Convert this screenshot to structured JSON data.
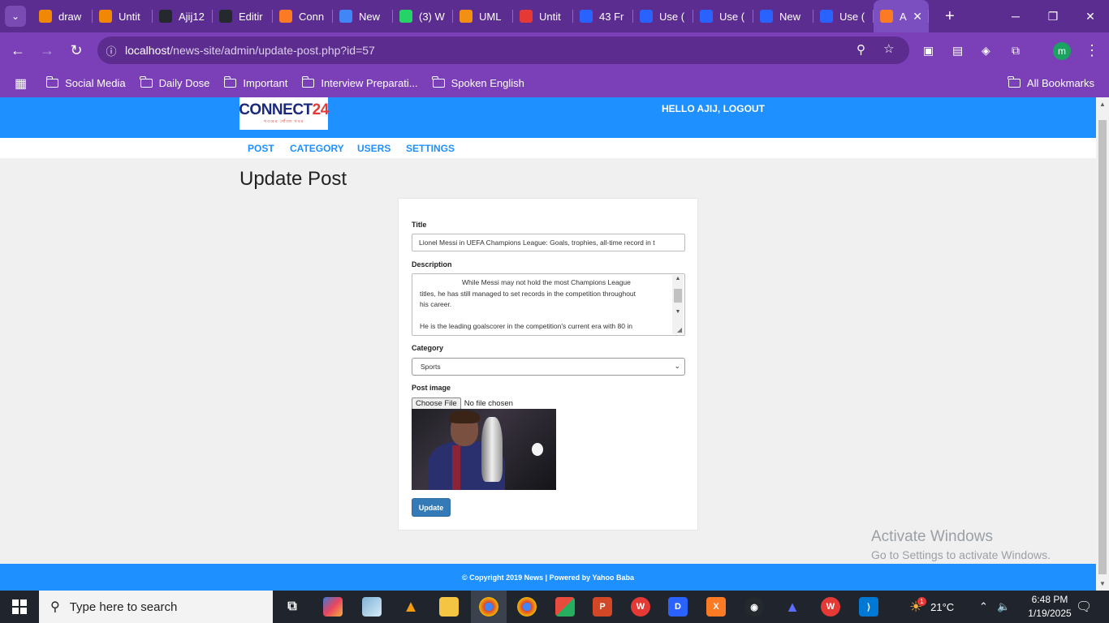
{
  "browser": {
    "tabs": [
      {
        "label": "draw",
        "icon": "drawio-icon",
        "color": "#f08705"
      },
      {
        "label": "Untit",
        "icon": "drawio-icon",
        "color": "#f08705"
      },
      {
        "label": "Ajij12",
        "icon": "github-icon",
        "color": "#24292e"
      },
      {
        "label": "Editir",
        "icon": "github-icon",
        "color": "#24292e"
      },
      {
        "label": "Conn",
        "icon": "xampp-icon",
        "color": "#fb7a24"
      },
      {
        "label": "New",
        "icon": "chrome-icon",
        "color": "#4285f4"
      },
      {
        "label": "(3) W",
        "icon": "whatsapp-icon",
        "color": "#25d366"
      },
      {
        "label": "UML",
        "icon": "uml-icon",
        "color": "#f29111"
      },
      {
        "label": "Untit",
        "icon": "codepen-icon",
        "color": "#e53935"
      },
      {
        "label": "43 Fr",
        "icon": "dsa-icon",
        "color": "#2962ff"
      },
      {
        "label": "Use (",
        "icon": "dsa-icon",
        "color": "#2962ff"
      },
      {
        "label": "Use (",
        "icon": "dsa-icon",
        "color": "#2962ff"
      },
      {
        "label": "New",
        "icon": "dsa-icon",
        "color": "#2962ff"
      },
      {
        "label": "Use (",
        "icon": "dsa-icon",
        "color": "#2962ff"
      }
    ],
    "active_tab": {
      "label": "A",
      "icon": "xampp-icon",
      "color": "#fb7a24"
    },
    "url_host": "localhost",
    "url_path": "/news-site/admin/update-post.php?id=57",
    "bookmarks": [
      "Social Media",
      "Daily Dose",
      "Important",
      "Interview Preparati...",
      "Spoken English"
    ],
    "all_bookmarks": "All Bookmarks",
    "profile_initial": "m"
  },
  "site": {
    "logo_text_main": "CONNECT",
    "logo_text_num": "24",
    "logo_tagline": "খবরের খোঁজে খবর",
    "greeting": "HELLO AJIJ, LOGOUT",
    "menu": [
      "POST",
      "CATEGORY",
      "USERS",
      "SETTINGS"
    ],
    "page_title": "Update Post",
    "footer": "© Copyright 2019 News | Powered by Yahoo Baba"
  },
  "form": {
    "title_label": "Title",
    "title_value": "Lionel Messi in UEFA Champions League: Goals, trophies, all-time record in t",
    "description_label": "Description",
    "description_lines": [
      "While Messi may not hold the most Champions League",
      "titles, he has still managed to set records in the competition throughout",
      "his career.",
      "",
      "He is the leading goalscorer in the competition's current era with 80 in"
    ],
    "category_label": "Category",
    "category_value": "Sports",
    "image_label": "Post image",
    "choose_file": "Choose File",
    "no_file": "No file chosen",
    "update_button": "Update"
  },
  "watermark": {
    "line1": "Activate Windows",
    "line2": "Go to Settings to activate Windows."
  },
  "taskbar": {
    "search_placeholder": "Type here to search",
    "weather": "21°C",
    "weather_badge": "1",
    "time": "6:48 PM",
    "date": "1/19/2025"
  }
}
